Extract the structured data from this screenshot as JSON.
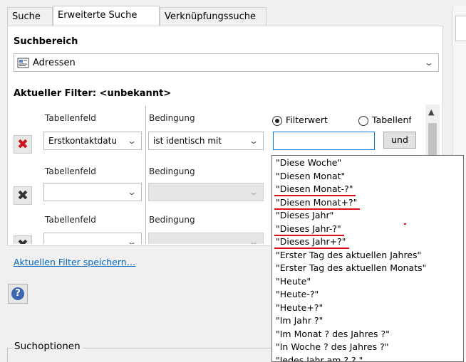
{
  "tabs": [
    {
      "label": "Suche"
    },
    {
      "label": "Erweiterte Suche"
    },
    {
      "label": "Verknüpfungssuche"
    }
  ],
  "suchbereich": {
    "label": "Suchbereich",
    "value": "Adressen"
  },
  "filter_title": "Aktueller Filter: <unbekannt>",
  "rows": [
    {
      "field_label": "Tabellenfeld",
      "cond_label": "Bedingung",
      "field_value": "Erstkontaktdatu",
      "cond_value": "ist identisch mit"
    },
    {
      "field_label": "Tabellenfeld",
      "cond_label": "Bedingung",
      "field_value": "",
      "cond_value": ""
    },
    {
      "field_label": "Tabellenfeld",
      "cond_label": "Bedingung",
      "field_value": "",
      "cond_value": ""
    }
  ],
  "value_options": {
    "filterwert": "Filterwert",
    "tabellenfeld": "Tabellenfe",
    "selected": "filterwert"
  },
  "und_label": "und",
  "filter_input_value": "",
  "save_link": "Aktuellen Filter speichern…",
  "help_label": "?",
  "suchoptionen": "Suchoptionen",
  "dropdown_items": [
    "\"Diese Woche\"",
    "\"Diesen Monat\"",
    "\"Diesen Monat-?\"",
    "\"Diesen Monat+?\"",
    "\"Dieses Jahr\"",
    "\"Dieses Jahr-?\"",
    "\"Dieses Jahr+?\"",
    "\"Erster Tag des aktuellen Jahres\"",
    "\"Erster Tag des aktuellen Monats\"",
    "\"Heute\"",
    "\"Heute-?\"",
    "\"Heute+?\"",
    "\"Im Jahr ?\"",
    "\"Im Monat ? des Jahres ?\"",
    "\"In Woche ? des Jahres ?\"",
    "\"Jedes Jahr am ?.?.\""
  ],
  "underlined_items": [
    2,
    3,
    5,
    6
  ],
  "colors": {
    "delete_active": "#d0131b",
    "delete_disabled": "#333333",
    "annotation_red": "#e0101a",
    "link": "#0067c0"
  },
  "icons": {
    "delete": "close-x-icon",
    "address_book": "address-book-icon",
    "help": "help-icon",
    "chevron": "chevron-down-icon"
  }
}
